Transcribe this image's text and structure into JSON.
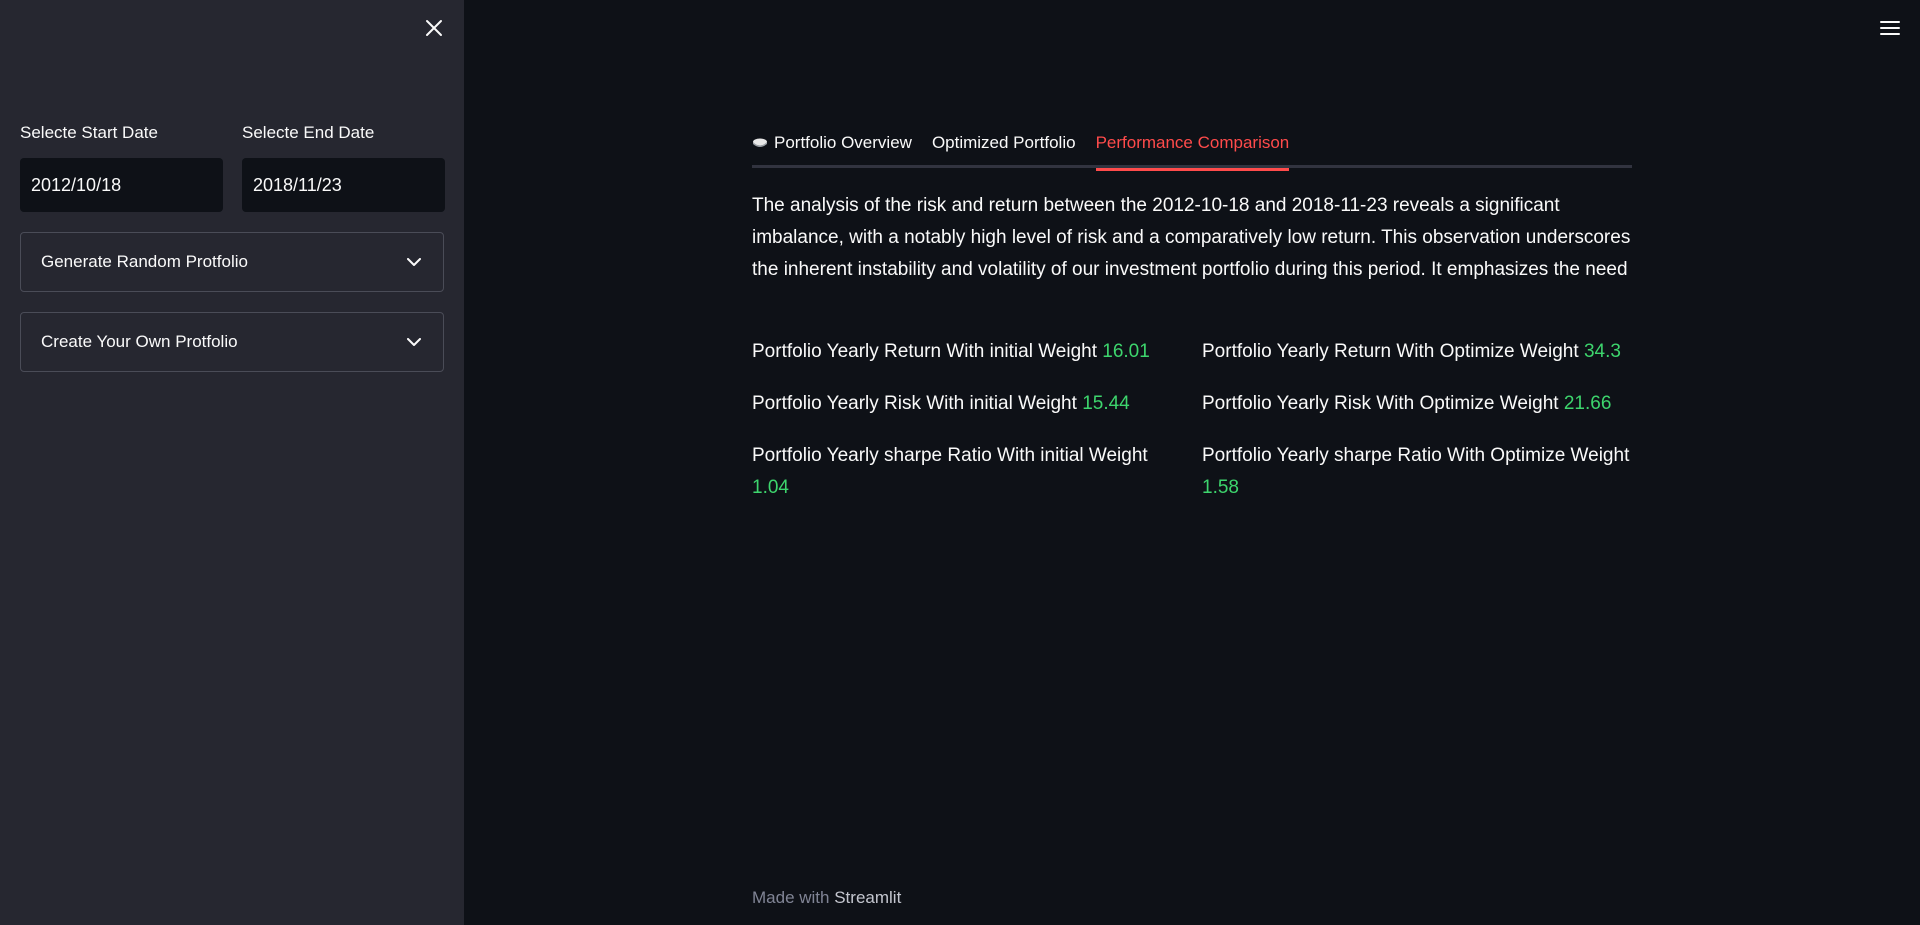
{
  "sidebar": {
    "start_date": {
      "label": "Selecte Start Date",
      "value": "2012/10/18"
    },
    "end_date": {
      "label": "Selecte End Date",
      "value": "2018/11/23"
    },
    "expanders": [
      {
        "label": "Generate Random Protfolio",
        "icon": "chevron-down-icon"
      },
      {
        "label": "Create Your Own Protfolio",
        "icon": "chevron-down-icon"
      }
    ]
  },
  "tabs": [
    {
      "label": "Portfolio Overview",
      "icon": "money-icon",
      "active": false
    },
    {
      "label": "Optimized Portfolio",
      "active": false
    },
    {
      "label": "Performance Comparison",
      "active": true
    }
  ],
  "main": {
    "analysis": "The analysis of the risk and return between the 2012-10-18 and 2018-11-23 reveals a significant imbalance, with a notably high level of risk and a comparatively low return. This observation underscores the inherent instability and volatility of our investment portfolio during this period. It emphasizes the need",
    "metrics": {
      "return_initial": {
        "label": "Portfolio Yearly Return With initial Weight",
        "value": "16.01"
      },
      "return_optimize": {
        "label": "Portfolio Yearly Return With Optimize Weight",
        "value": "34.3"
      },
      "risk_initial": {
        "label": "Portfolio Yearly Risk With initial Weight",
        "value": "15.44"
      },
      "risk_optimize": {
        "label": "Portfolio Yearly Risk With Optimize Weight",
        "value": "21.66"
      },
      "sharpe_initial": {
        "label": "Portfolio Yearly sharpe Ratio With initial Weight",
        "value": "1.04"
      },
      "sharpe_optimize": {
        "label": "Portfolio Yearly sharpe Ratio With Optimize Weight",
        "value": "1.58"
      }
    }
  },
  "footer": {
    "prefix": "Made with",
    "brand": "Streamlit"
  },
  "colors": {
    "background": "#0e1117",
    "sidebar": "#262730",
    "accent": "#ff4b4b",
    "positive": "#3dd56d"
  }
}
